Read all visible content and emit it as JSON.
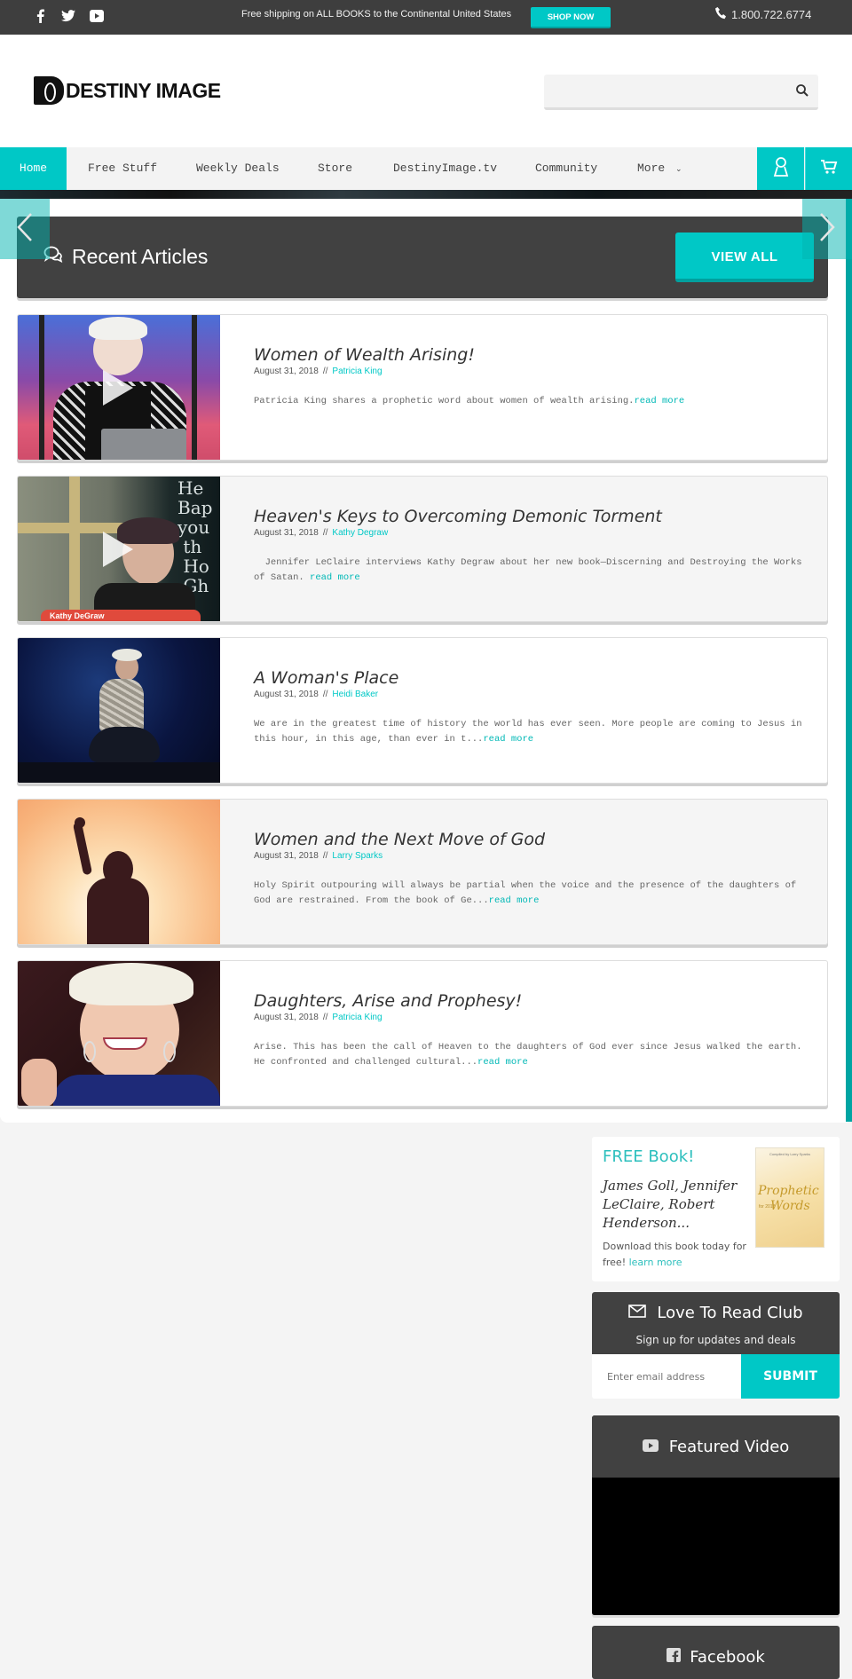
{
  "topbar": {
    "social": [
      "facebook",
      "twitter",
      "youtube"
    ],
    "promo": "Free shipping on ALL BOOKS to the Continental United States",
    "shop_now": "SHOP NOW",
    "phone": "1.800.722.6774"
  },
  "header": {
    "logo_text": "DESTINY IMAGE",
    "search_placeholder": ""
  },
  "nav": {
    "items": [
      {
        "label": "Home",
        "active": true
      },
      {
        "label": "Free Stuff"
      },
      {
        "label": "Weekly Deals"
      },
      {
        "label": "Store"
      },
      {
        "label": "DestinyImage.tv"
      },
      {
        "label": "Community"
      },
      {
        "label": "More"
      }
    ]
  },
  "colors": {
    "accent": "#00c8c6",
    "dark": "#414141",
    "topbar": "#3e3e3e"
  },
  "recent": {
    "title": "Recent Articles",
    "view_all": "VIEW ALL",
    "articles": [
      {
        "title": "Women of Wealth Arising!",
        "date": "August 31, 2018",
        "sep": "//",
        "author": "Patricia King",
        "excerpt": "Patricia King shares a prophetic word about women of wealth arising.",
        "more": "read more",
        "has_video": true
      },
      {
        "title": "Heaven's Keys to Overcoming Demonic Torment",
        "date": "August 31, 2018",
        "sep": "//",
        "author": "Kathy Degraw",
        "excerpt": "  Jennifer LeClaire interviews Kathy Degraw about her new book—Discerning and Destroying the Works of Satan. ",
        "more": "read more",
        "has_video": true,
        "thumb_caption": "Kathy DeGraw"
      },
      {
        "title": "A Woman's Place",
        "date": "August 31, 2018",
        "sep": "//",
        "author": "Heidi Baker",
        "excerpt": "We are in the greatest time of history the world has ever seen. More people are coming to Jesus in this hour, in this age, than ever in t...",
        "more": "read more"
      },
      {
        "title": "Women and the Next Move of God",
        "date": "August 31, 2018",
        "sep": "//",
        "author": "Larry Sparks",
        "excerpt": "Holy Spirit outpouring will always be partial when the voice and the presence of the daughters of God are restrained. From the book of Ge...",
        "more": "read more"
      },
      {
        "title": "Daughters, Arise and Prophesy!",
        "date": "August 31, 2018",
        "sep": "//",
        "author": "Patricia King",
        "excerpt": "Arise. This has been the call of Heaven to the daughters of God ever since Jesus walked the earth. He confronted and challenged cultural...",
        "more": "read more"
      }
    ]
  },
  "sidebar": {
    "free_book": {
      "title": "FREE Book!",
      "authors": "James Goll, Jennifer LeClaire, Robert Henderson...",
      "desc": "Download this book today for free! ",
      "link": "learn more",
      "cover": {
        "compiled": "Compiled by Larry Sparks",
        "title1": "Prophetic",
        "title2": "Words",
        "year": "for 2018"
      }
    },
    "club": {
      "title": "Love To Read Club",
      "subtitle": "Sign up for updates and deals",
      "email_placeholder": "Enter email address",
      "submit": "SUBMIT"
    },
    "video": {
      "title": "Featured Video"
    },
    "facebook": {
      "title": "Facebook"
    }
  }
}
